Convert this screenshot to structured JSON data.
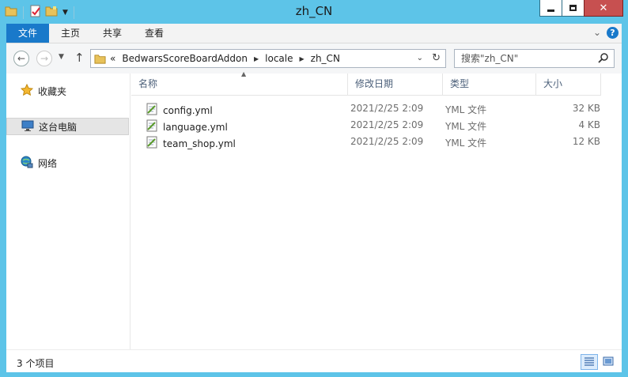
{
  "window": {
    "title": "zh_CN"
  },
  "qat": {
    "icons": [
      "folder-icon",
      "properties-icon",
      "new-folder-icon"
    ]
  },
  "ribbon": {
    "tabs": [
      {
        "label": "文件"
      },
      {
        "label": "主页"
      },
      {
        "label": "共享"
      },
      {
        "label": "查看"
      }
    ],
    "help_label": "?"
  },
  "address": {
    "overflow": "«",
    "breadcrumbs": [
      "BedwarsScoreBoardAddon",
      "locale",
      "zh_CN"
    ]
  },
  "search": {
    "placeholder": "搜索\"zh_CN\""
  },
  "nav": {
    "items": [
      {
        "label": "收藏夹",
        "icon": "star-icon"
      },
      {
        "label": "这台电脑",
        "icon": "computer-icon"
      },
      {
        "label": "网络",
        "icon": "network-icon"
      }
    ]
  },
  "columns": [
    "名称",
    "修改日期",
    "类型",
    "大小"
  ],
  "files": [
    {
      "name": "config.yml",
      "date": "2021/2/25 2:09",
      "type": "YML 文件",
      "size": "32 KB"
    },
    {
      "name": "language.yml",
      "date": "2021/2/25 2:09",
      "type": "YML 文件",
      "size": "4 KB"
    },
    {
      "name": "team_shop.yml",
      "date": "2021/2/25 2:09",
      "type": "YML 文件",
      "size": "12 KB"
    }
  ],
  "status": {
    "text": "3 个项目"
  },
  "colors": {
    "titlebar": "#5dc4e8",
    "file_tab": "#1979ca",
    "close": "#c75050"
  }
}
